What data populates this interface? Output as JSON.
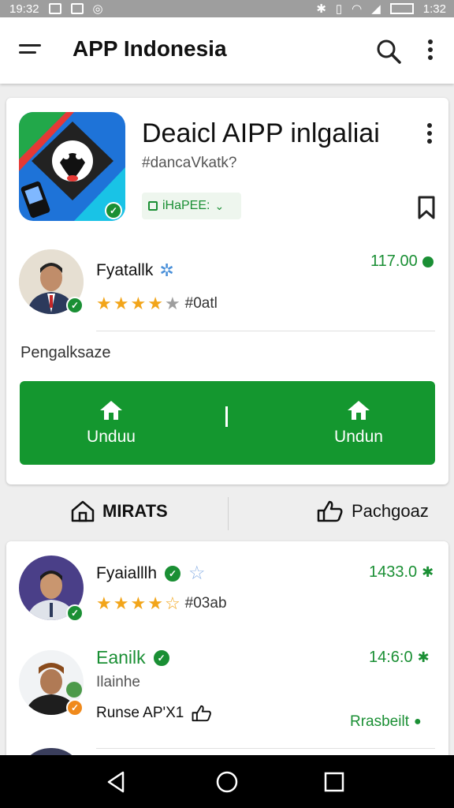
{
  "status_bar": {
    "time_left": "19:32",
    "time_right": "1:32"
  },
  "app_bar": {
    "title": "APP Indonesia"
  },
  "detail": {
    "title": "Deaicl AIPP inlgaliai",
    "tag": "#dancaVkatk?",
    "chip_label": "iHaPEE:",
    "seller": {
      "name": "Fyatallk",
      "rating": 4.5,
      "rating_text": "#0atl",
      "price": "117.00"
    },
    "section_label": "Pengalksaze",
    "download_left_label": "Unduu",
    "download_right_label": "Undun"
  },
  "tabs": [
    {
      "label": "MIRATS"
    },
    {
      "label": "Pachgoaz"
    }
  ],
  "list": [
    {
      "name": "Fyaialllh",
      "rating": 4.5,
      "rating_text": "#03ab",
      "price": "1433.0"
    },
    {
      "name": "Eanilk",
      "subtitle": "Ilainhe",
      "bundle": "Runse AP'X1",
      "price": "14:6:0",
      "status": "Rrasbeilt"
    }
  ],
  "colors": {
    "accent_green": "#14972f",
    "star": "#f2a51a"
  },
  "icons": [
    "menu-icon",
    "search-icon",
    "more-vert-icon",
    "bookmark-icon",
    "verified-icon",
    "home-icon",
    "back-icon",
    "home-circle-icon",
    "recents-icon"
  ]
}
